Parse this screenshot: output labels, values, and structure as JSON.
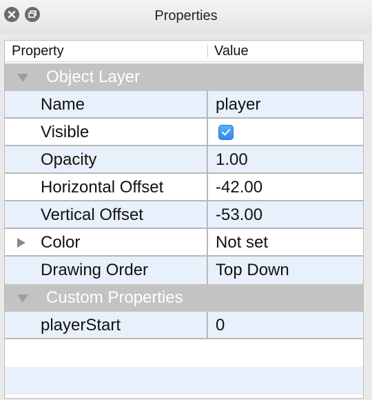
{
  "window": {
    "title": "Properties"
  },
  "columns": {
    "property": "Property",
    "value": "Value"
  },
  "groups": {
    "object_layer": "Object Layer",
    "custom_properties": "Custom Properties"
  },
  "rows": {
    "name": {
      "label": "Name",
      "value": "player"
    },
    "visible": {
      "label": "Visible",
      "checked": true
    },
    "opacity": {
      "label": "Opacity",
      "value": "1.00"
    },
    "horizontal_offset": {
      "label": "Horizontal Offset",
      "value": "-42.00"
    },
    "vertical_offset": {
      "label": "Vertical Offset",
      "value": "-53.00"
    },
    "color": {
      "label": "Color",
      "value": "Not set"
    },
    "drawing_order": {
      "label": "Drawing Order",
      "value": "Top Down"
    },
    "player_start": {
      "label": "playerStart",
      "value": "0"
    }
  },
  "icons": {
    "close": "close-icon",
    "float": "float-window-icon",
    "expand": "triangle-down-icon",
    "collapse": "triangle-right-icon",
    "check": "checkmark-icon"
  },
  "colors": {
    "group_header": "#c3c3c3",
    "row_alt": "#e8f0fb",
    "checkbox": "#2d86f0"
  }
}
